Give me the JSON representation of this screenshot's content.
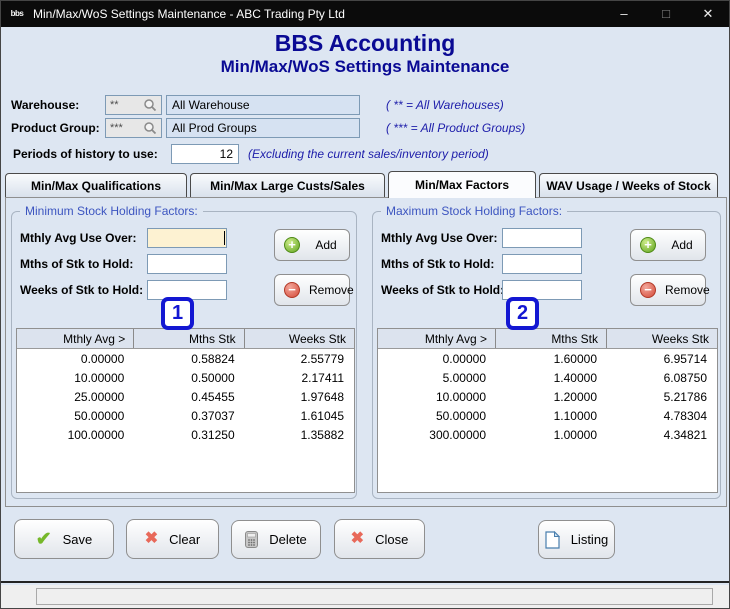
{
  "colors": {
    "titlebar_bg": "#0b0b0b",
    "window_bg": "#dde6f2",
    "header_navy": "#0a0a94",
    "note_blue": "#1d1daa",
    "group_label_blue": "#3c55c0",
    "badge_blue": "#1317d2",
    "add_green": "#61a51f",
    "remove_red": "#d44a38",
    "save_check_green": "#76b82a",
    "clear_cross_red": "#e8695a",
    "focused_input_cream": "#fdf2d2",
    "readonly_field_blue": "#d6e2f2"
  },
  "icons": {
    "app": "bbs-logo",
    "lookup": "magnifier",
    "add": "plus-circle-green",
    "remove": "minus-circle-red",
    "save": "green-check",
    "clear": "red-cross",
    "delete": "calculator",
    "close": "red-cross",
    "listing": "document-page"
  },
  "window": {
    "title": "Min/Max/WoS Settings Maintenance - ABC Trading Pty Ltd",
    "icon_text": "bbs",
    "minimize": "–",
    "maximize": "□",
    "close": "✕"
  },
  "header": {
    "app_title": "BBS Accounting",
    "screen_title": "Min/Max/WoS Settings Maintenance"
  },
  "filters": {
    "warehouse": {
      "label": "Warehouse:",
      "code": "**",
      "value": "All Warehouse",
      "note": "( ** = All Warehouses)"
    },
    "product_group": {
      "label": "Product Group:",
      "code": "***",
      "value": "All Prod Groups",
      "note": "( *** = All Product Groups)"
    },
    "periods": {
      "label": "Periods of history to use:",
      "value": "12",
      "note": "(Excluding the current sales/inventory period)"
    }
  },
  "tabs": {
    "items": [
      {
        "label": "Min/Max Qualifications",
        "active": false
      },
      {
        "label": "Min/Max Large Custs/Sales",
        "active": false
      },
      {
        "label": "Min/Max Factors",
        "active": true
      },
      {
        "label": "WAV Usage / Weeks of Stock",
        "active": false
      }
    ]
  },
  "panels": {
    "min": {
      "title": "Minimum Stock Holding Factors:",
      "badge": "1",
      "fields": {
        "avg_label": "Mthly Avg Use Over:",
        "avg_value": "",
        "mths_label": "Mths of Stk to Hold:",
        "mths_value": "",
        "weeks_label": "Weeks of Stk to Hold:",
        "weeks_value": ""
      },
      "add_label": "Add",
      "remove_label": "Remove",
      "table": {
        "headers": [
          "Mthly Avg >",
          "Mths Stk",
          "Weeks Stk"
        ],
        "rows": [
          [
            "0.00000",
            "0.58824",
            "2.55779"
          ],
          [
            "10.00000",
            "0.50000",
            "2.17411"
          ],
          [
            "25.00000",
            "0.45455",
            "1.97648"
          ],
          [
            "50.00000",
            "0.37037",
            "1.61045"
          ],
          [
            "100.00000",
            "0.31250",
            "1.35882"
          ]
        ]
      }
    },
    "max": {
      "title": "Maximum Stock Holding Factors:",
      "badge": "2",
      "fields": {
        "avg_label": "Mthly Avg Use Over:",
        "avg_value": "",
        "mths_label": "Mths of Stk to Hold:",
        "mths_value": "",
        "weeks_label": "Weeks of Stk to Hold:",
        "weeks_value": ""
      },
      "add_label": "Add",
      "remove_label": "Remove",
      "table": {
        "headers": [
          "Mthly Avg >",
          "Mths Stk",
          "Weeks Stk"
        ],
        "rows": [
          [
            "0.00000",
            "1.60000",
            "6.95714"
          ],
          [
            "5.00000",
            "1.40000",
            "6.08750"
          ],
          [
            "10.00000",
            "1.20000",
            "5.21786"
          ],
          [
            "50.00000",
            "1.10000",
            "4.78304"
          ],
          [
            "300.00000",
            "1.00000",
            "4.34821"
          ]
        ]
      }
    }
  },
  "actions": {
    "save": "Save",
    "clear": "Clear",
    "delete": "Delete",
    "close": "Close",
    "listing": "Listing"
  },
  "status": {
    "text": ""
  }
}
